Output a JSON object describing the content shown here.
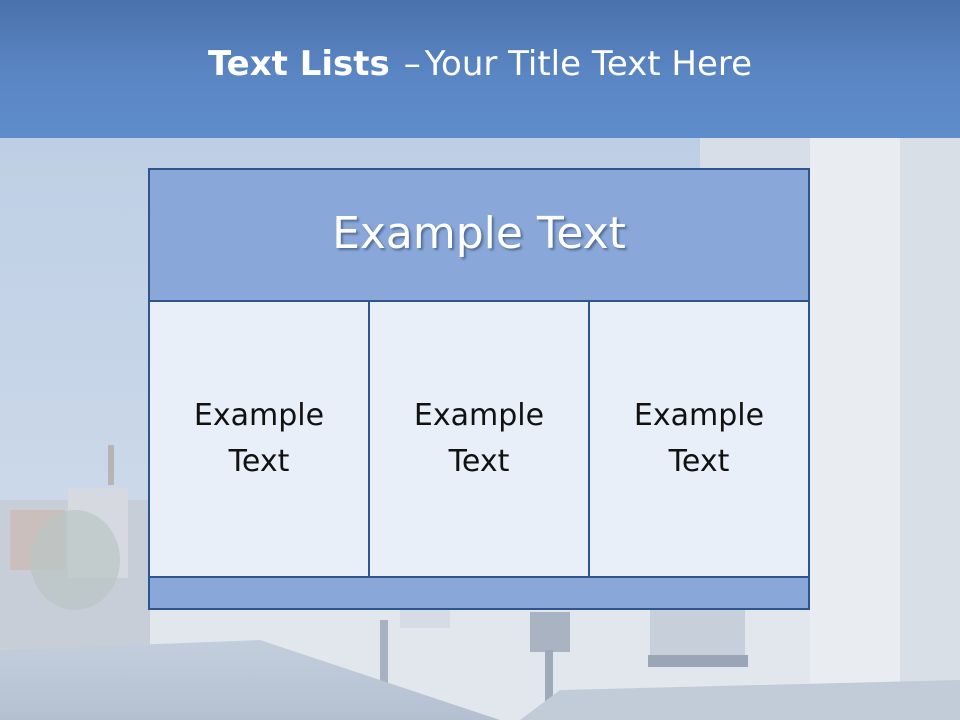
{
  "slide": {
    "title_bold": "Text Lists",
    "title_dash": "–",
    "title_rest": "Your Title Text Here"
  },
  "box": {
    "header_text": "Example Text",
    "cells": [
      {
        "text": "Example Text"
      },
      {
        "text": "Example Text"
      },
      {
        "text": "Example Text"
      }
    ]
  },
  "colors": {
    "header_band": "#5a86c4",
    "box_header": "#89a8d9",
    "cell_fill": "#e8eff9",
    "border": "#2f558f"
  }
}
